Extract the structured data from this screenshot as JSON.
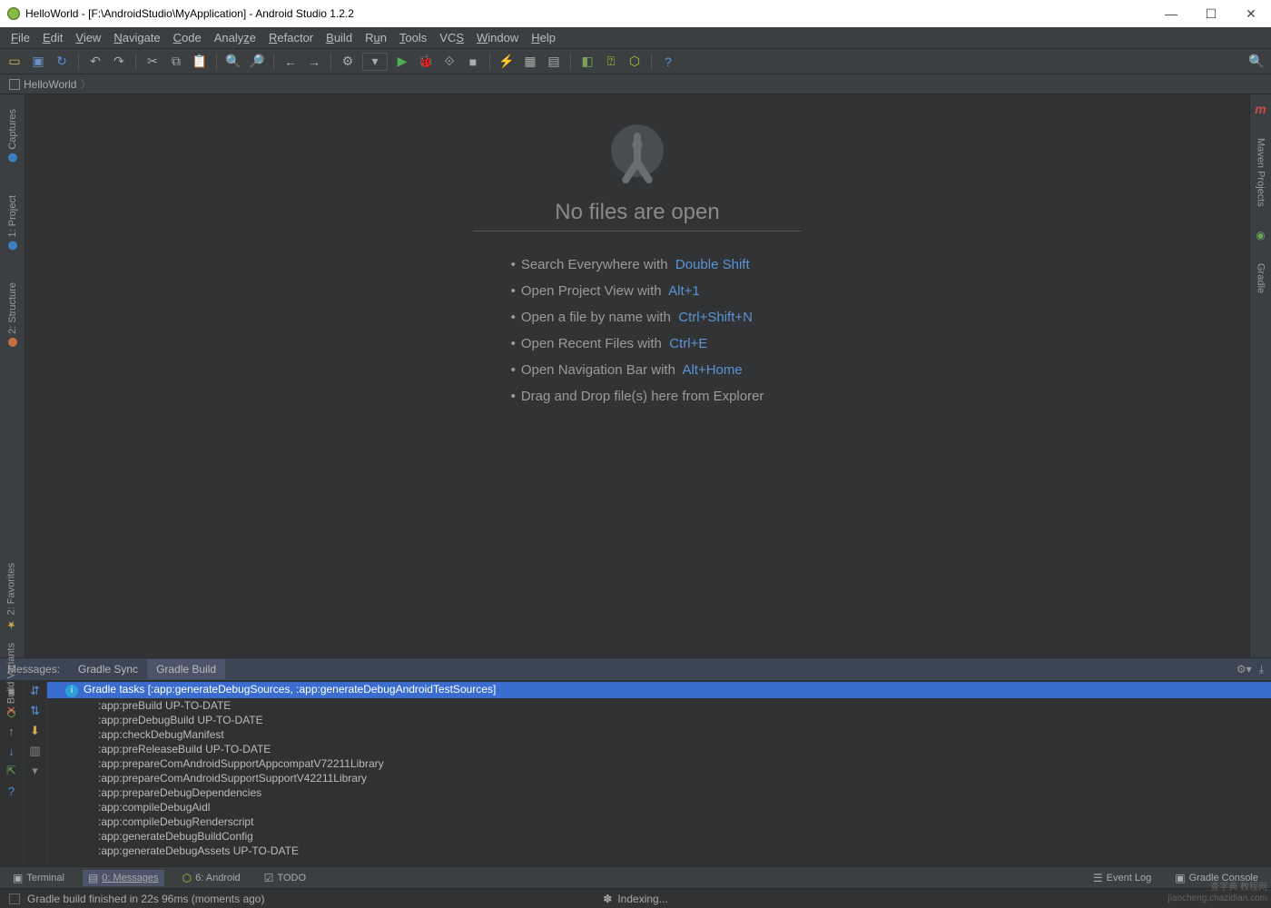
{
  "title": "HelloWorld - [F:\\AndroidStudio\\MyApplication] - Android Studio 1.2.2",
  "menu": [
    "File",
    "Edit",
    "View",
    "Navigate",
    "Code",
    "Analyze",
    "Refactor",
    "Build",
    "Run",
    "Tools",
    "VCS",
    "Window",
    "Help"
  ],
  "breadcrumb": "HelloWorld",
  "leftTabs": [
    "Captures",
    "1: Project",
    "2: Structure"
  ],
  "rightTabs": [
    "Maven Projects",
    "Gradle"
  ],
  "editor": {
    "heading": "No files are open",
    "tips": [
      {
        "text": "Search Everywhere with",
        "key": "Double Shift"
      },
      {
        "text": "Open Project View with",
        "key": "Alt+1"
      },
      {
        "text": "Open a file by name with",
        "key": "Ctrl+Shift+N"
      },
      {
        "text": "Open Recent Files with",
        "key": "Ctrl+E"
      },
      {
        "text": "Open Navigation Bar with",
        "key": "Alt+Home"
      },
      {
        "text": "Drag and Drop file(s) here from Explorer",
        "key": ""
      }
    ]
  },
  "messagesPanel": {
    "label": "Messages:",
    "tabs": [
      "Gradle Sync",
      "Gradle Build"
    ],
    "activeTab": 1,
    "selected": "Gradle tasks [:app:generateDebugSources, :app:generateDebugAndroidTestSources]",
    "rows": [
      ":app:preBuild UP-TO-DATE",
      ":app:preDebugBuild UP-TO-DATE",
      ":app:checkDebugManifest",
      ":app:preReleaseBuild UP-TO-DATE",
      ":app:prepareComAndroidSupportAppcompatV72211Library",
      ":app:prepareComAndroidSupportSupportV42211Library",
      ":app:prepareDebugDependencies",
      ":app:compileDebugAidl",
      ":app:compileDebugRenderscript",
      ":app:generateDebugBuildConfig",
      ":app:generateDebugAssets UP-TO-DATE"
    ]
  },
  "bottomTabs": {
    "items": [
      "Terminal",
      "0: Messages",
      "6: Android",
      "TODO"
    ],
    "active": 1,
    "right": [
      "Event Log",
      "Gradle Console"
    ]
  },
  "status": {
    "left": "Gradle build finished in 22s 96ms (moments ago)",
    "center": "Indexing..."
  },
  "watermark": {
    "l1": "查字典 教程网",
    "l2": "jiaocheng.chazidian.com"
  }
}
